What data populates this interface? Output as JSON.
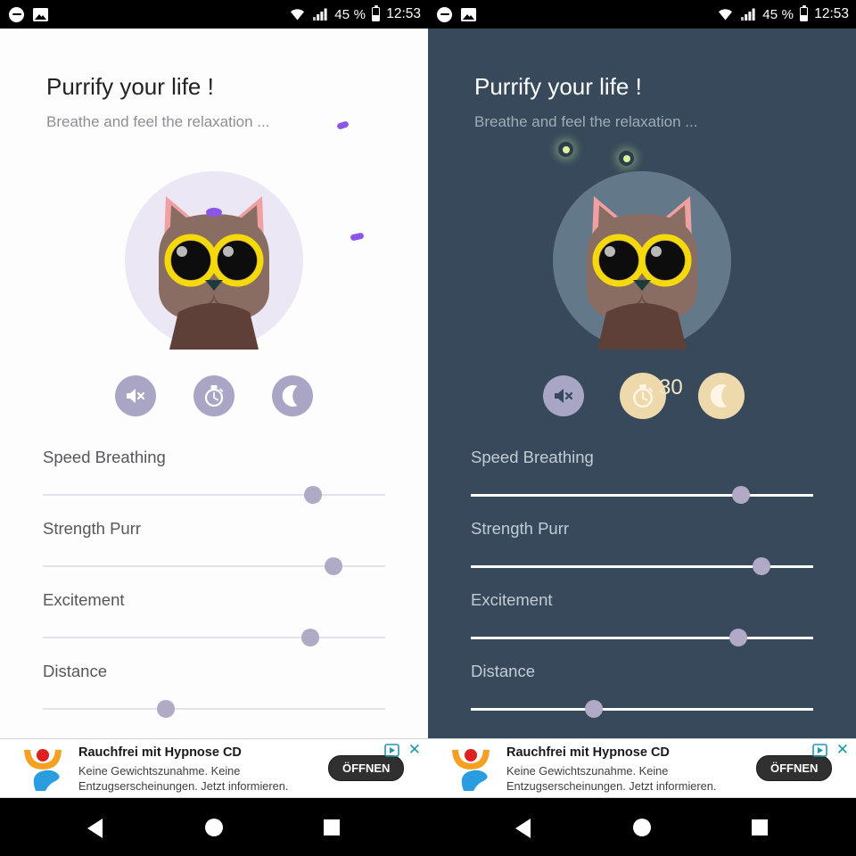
{
  "status_bar": {
    "icons": [
      "do-not-disturb-icon",
      "photo-icon",
      "wifi-icon",
      "signal-icon"
    ],
    "battery_percent": "45 %",
    "time": "12:53"
  },
  "app": {
    "title": "Purrify your life !",
    "subtitle": "Breathe and feel the relaxation ..."
  },
  "panels": [
    {
      "theme": "light",
      "background": "#fdfdfe",
      "circle_color": "#ece7f4",
      "night_mode_active": false,
      "timer_active": false,
      "timer_value": ""
    },
    {
      "theme": "dark",
      "background": "#37495a",
      "circle_color": "#63798a",
      "night_mode_active": true,
      "timer_active": true,
      "timer_value": "30"
    }
  ],
  "actions": [
    {
      "name": "mute-button",
      "icon": "speaker-mute-icon",
      "label": "Mute",
      "active": false
    },
    {
      "name": "timer-button",
      "icon": "stopwatch-icon",
      "label": "Timer",
      "active": false
    },
    {
      "name": "night-mode-button",
      "icon": "moon-icon",
      "label": "Night mode",
      "active": false
    }
  ],
  "sliders": [
    {
      "label": "Speed Breathing",
      "value": 79
    },
    {
      "label": "Strength Purr",
      "value": 85
    },
    {
      "label": "Excitement",
      "value": 78
    },
    {
      "label": "Distance",
      "value": 36
    }
  ],
  "ad": {
    "title": "Rauchfrei mit Hypnose CD",
    "description": "Keine Gewichtszunahme. Keine Entzugserscheinungen. Jetzt informieren.",
    "cta": "ÖFFNEN",
    "adchoices_icon": "adchoices-icon",
    "close_icon": "close-icon"
  },
  "nav_bar": {
    "back": "back-button",
    "home": "home-button",
    "recents": "recents-button"
  },
  "colors": {
    "accent_purple": "#8a56e8",
    "thumb": "#b0aac6",
    "active_amber": "#eed9ad",
    "glow_green": "#d9f59a"
  }
}
